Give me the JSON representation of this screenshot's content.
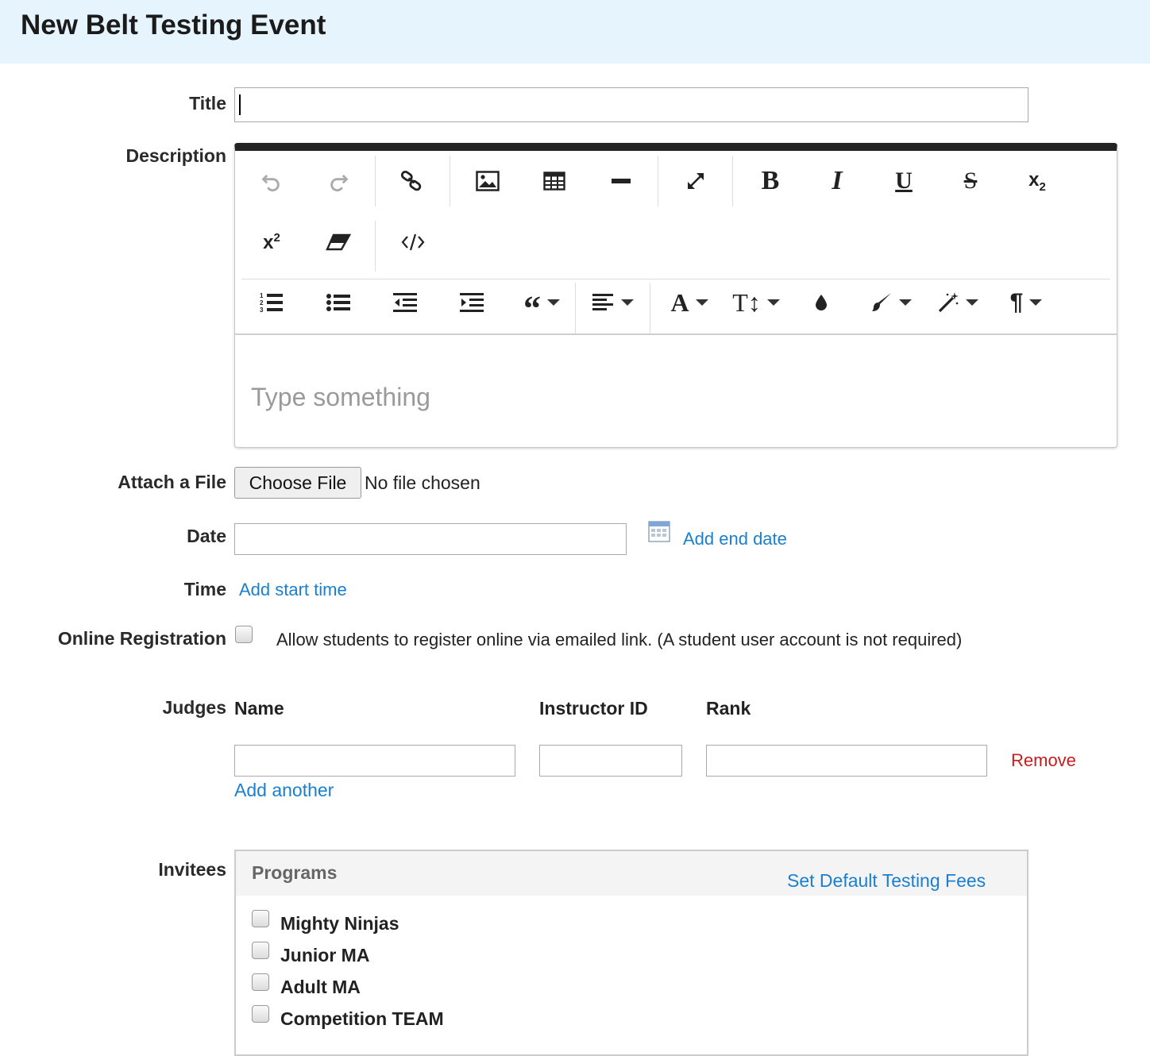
{
  "page": {
    "title": "New Belt Testing Event"
  },
  "form": {
    "title_label": "Title",
    "title_value": "",
    "description_label": "Description",
    "description_placeholder": "Type something",
    "attach_label": "Attach a File",
    "choose_file_label": "Choose File",
    "no_file_text": "No file chosen",
    "date_label": "Date",
    "date_value": "",
    "add_end_date": "Add end date",
    "time_label": "Time",
    "add_start_time": "Add start time",
    "online_reg_label": "Online Registration",
    "online_reg_text": "Allow students to register online via emailed link. (A student user account is not required)",
    "online_reg_checked": false
  },
  "toolbar": {
    "row1": [
      "undo-icon",
      "redo-icon",
      "link-icon",
      "image-icon",
      "table-icon",
      "horizontal-rule-icon",
      "fullscreen-icon",
      "bold-icon",
      "italic-icon",
      "underline-icon",
      "strikethrough-icon",
      "subscript-icon"
    ],
    "row2": [
      "superscript-icon",
      "eraser-icon",
      "code-view-icon"
    ],
    "row3": [
      "ordered-list-icon",
      "unordered-list-icon",
      "outdent-icon",
      "indent-icon",
      "blockquote-icon",
      "align-icon",
      "font-family-icon",
      "font-size-icon",
      "text-color-icon",
      "background-color-icon",
      "inline-style-icon",
      "paragraph-style-icon"
    ]
  },
  "judges": {
    "label": "Judges",
    "col_name": "Name",
    "col_instructor_id": "Instructor ID",
    "col_rank": "Rank",
    "row": {
      "name": "",
      "instructor_id": "",
      "rank": ""
    },
    "remove_label": "Remove",
    "add_another": "Add another"
  },
  "invitees": {
    "label": "Invitees",
    "programs_title": "Programs",
    "set_default_fees": "Set Default Testing Fees",
    "programs": [
      {
        "name": "Mighty Ninjas",
        "checked": false
      },
      {
        "name": "Junior MA",
        "checked": false
      },
      {
        "name": "Adult MA",
        "checked": false
      },
      {
        "name": "Competition TEAM",
        "checked": false
      }
    ]
  },
  "colors": {
    "header_bg": "#e6f4fd",
    "link": "#1a7fd0",
    "remove": "#c81c1c"
  }
}
